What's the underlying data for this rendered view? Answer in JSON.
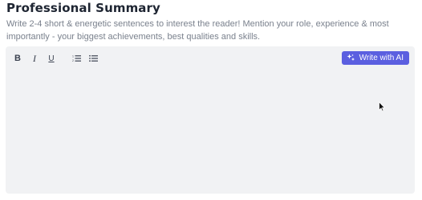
{
  "section": {
    "title": "Professional Summary",
    "description": "Write 2-4 short & energetic sentences to interest the reader! Mention your role, experience & most importantly - your biggest achievements, best qualities and skills."
  },
  "toolbar": {
    "bold_label": "B",
    "italic_label": "I",
    "underline_label": "U",
    "numbered_list_icon": "numbered-list-icon",
    "bulleted_list_icon": "bulleted-list-icon"
  },
  "ai_button": {
    "label": "Write with AI",
    "icon": "sparkle-icon",
    "color": "#5b5fe0"
  },
  "editor": {
    "value": ""
  }
}
